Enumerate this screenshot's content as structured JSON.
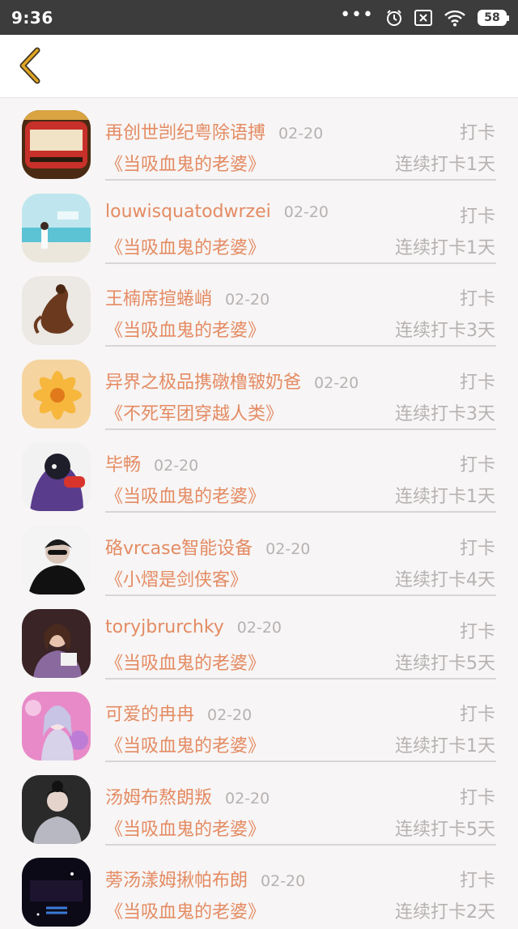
{
  "status_bar": {
    "time": "9:36",
    "battery": "58",
    "icons": [
      "more-dots-icon",
      "alarm-icon",
      "sim-off-icon",
      "wifi-icon",
      "battery-icon"
    ]
  },
  "navbar": {
    "back_icon": "chevron-left-icon",
    "accent": "#e0a526"
  },
  "colors": {
    "name": "#e48b63",
    "muted": "#b7b2b2",
    "divider": "#d9d5d5"
  },
  "entries": [
    {
      "name": "再创世剀纪粤除语搏",
      "date": "02-20",
      "action": "打卡",
      "book": "《当吸血鬼的老婆》",
      "streak": "连续打卡1天"
    },
    {
      "name": "louwisquatodwrzei",
      "date": "02-20",
      "action": "打卡",
      "book": "《当吸血鬼的老婆》",
      "streak": "连续打卡1天"
    },
    {
      "name": "王楠席揎蜷峭",
      "date": "02-20",
      "action": "打卡",
      "book": "《当吸血鬼的老婆》",
      "streak": "连续打卡3天"
    },
    {
      "name": "异界之极品携礅橹皲奶爸",
      "date": "02-20",
      "action": "打卡",
      "book": "《不死军团穿越人类》",
      "streak": "连续打卡3天"
    },
    {
      "name": "毕畅",
      "date": "02-20",
      "action": "打卡",
      "book": "《当吸血鬼的老婆》",
      "streak": "连续打卡1天"
    },
    {
      "name": "硌vrcase智能设备",
      "date": "02-20",
      "action": "打卡",
      "book": "《小熠是剑侠客》",
      "streak": "连续打卡4天"
    },
    {
      "name": "toryjbrurchky",
      "date": "02-20",
      "action": "打卡",
      "book": "《当吸血鬼的老婆》",
      "streak": "连续打卡5天"
    },
    {
      "name": "可爱的冉冉",
      "date": "02-20",
      "action": "打卡",
      "book": "《当吸血鬼的老婆》",
      "streak": "连续打卡1天"
    },
    {
      "name": "汤姆布熬朗叛",
      "date": "02-20",
      "action": "打卡",
      "book": "《当吸血鬼的老婆》",
      "streak": "连续打卡5天"
    },
    {
      "name": "蒡汤漾姆揪帕布朗",
      "date": "02-20",
      "action": "打卡",
      "book": "《当吸血鬼的老婆》",
      "streak": "连续打卡2天"
    }
  ]
}
